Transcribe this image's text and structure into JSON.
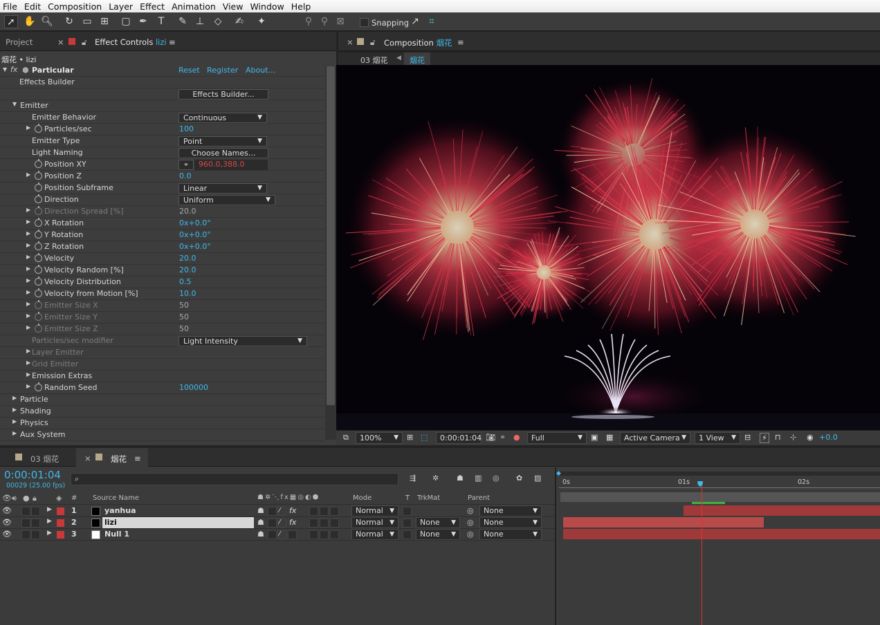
{
  "menu": [
    "File",
    "Edit",
    "Composition",
    "Layer",
    "Effect",
    "Animation",
    "View",
    "Window",
    "Help"
  ],
  "toolbar": {
    "snapping_label": "Snapping"
  },
  "left_tabs": {
    "project": "Project",
    "effect_controls_prefix": "Effect Controls",
    "effect_controls_layer": "lizi"
  },
  "breadcrumb": "烟花 • lizi",
  "effect": {
    "name": "Particular",
    "reset": "Reset",
    "register": "Register",
    "about": "About...",
    "rows": [
      {
        "label": "Effects Builder",
        "indent": 1,
        "tri": "",
        "sw": false,
        "dim": false
      },
      {
        "label": "",
        "indent": 1,
        "tri": "",
        "sw": false,
        "dim": false,
        "button": "Effects Builder..."
      },
      {
        "label": "Emitter",
        "indent": 0,
        "tri": "open",
        "sw": false,
        "dim": false
      },
      {
        "label": "Emitter Behavior",
        "indent": 2,
        "tri": "",
        "sw": false,
        "dim": false,
        "dropdown": "Continuous"
      },
      {
        "label": "Particles/sec",
        "indent": 2,
        "tri": "closed",
        "sw": true,
        "dim": false,
        "value": "100",
        "vclass": "blue"
      },
      {
        "label": "Emitter Type",
        "indent": 2,
        "tri": "",
        "sw": false,
        "dim": false,
        "dropdown": "Point"
      },
      {
        "label": "Light Naming",
        "indent": 2,
        "tri": "",
        "sw": false,
        "dim": false,
        "button": "Choose Names..."
      },
      {
        "label": "Position XY",
        "indent": 2,
        "tri": "",
        "sw": true,
        "dim": false,
        "value": "960.0,388.0",
        "vclass": "red",
        "crosshair": true
      },
      {
        "label": "Position Z",
        "indent": 2,
        "tri": "closed",
        "sw": true,
        "dim": false,
        "value": "0.0",
        "vclass": "blue"
      },
      {
        "label": "Position Subframe",
        "indent": 2,
        "tri": "",
        "sw": true,
        "dim": false,
        "dropdown": "Linear"
      },
      {
        "label": "Direction",
        "indent": 2,
        "tri": "",
        "sw": true,
        "dim": false,
        "dropdown": "Uniform",
        "ddwide": true
      },
      {
        "label": "Direction Spread [%]",
        "indent": 2,
        "tri": "closed",
        "sw": true,
        "dim": true,
        "value": "20.0",
        "vclass": "gray"
      },
      {
        "label": "X Rotation",
        "indent": 2,
        "tri": "closed",
        "sw": true,
        "dim": false,
        "value": "0x+0.0°",
        "vclass": "blue"
      },
      {
        "label": "Y Rotation",
        "indent": 2,
        "tri": "closed",
        "sw": true,
        "dim": false,
        "value": "0x+0.0°",
        "vclass": "blue"
      },
      {
        "label": "Z Rotation",
        "indent": 2,
        "tri": "closed",
        "sw": true,
        "dim": false,
        "value": "0x+0.0°",
        "vclass": "blue"
      },
      {
        "label": "Velocity",
        "indent": 2,
        "tri": "closed",
        "sw": true,
        "dim": false,
        "value": "20.0",
        "vclass": "blue"
      },
      {
        "label": "Velocity Random [%]",
        "indent": 2,
        "tri": "closed",
        "sw": true,
        "dim": false,
        "value": "20.0",
        "vclass": "blue"
      },
      {
        "label": "Velocity Distribution",
        "indent": 2,
        "tri": "closed",
        "sw": true,
        "dim": false,
        "value": "0.5",
        "vclass": "blue"
      },
      {
        "label": "Velocity from Motion [%]",
        "indent": 2,
        "tri": "closed",
        "sw": true,
        "dim": false,
        "value": "10.0",
        "vclass": "blue"
      },
      {
        "label": "Emitter Size X",
        "indent": 2,
        "tri": "closed",
        "sw": true,
        "dim": true,
        "value": "50",
        "vclass": "gray"
      },
      {
        "label": "Emitter Size Y",
        "indent": 2,
        "tri": "closed",
        "sw": true,
        "dim": true,
        "value": "50",
        "vclass": "gray"
      },
      {
        "label": "Emitter Size Z",
        "indent": 2,
        "tri": "closed",
        "sw": true,
        "dim": true,
        "value": "50",
        "vclass": "gray"
      },
      {
        "label": "Particles/sec modifier",
        "indent": 2,
        "tri": "",
        "sw": false,
        "dim": true,
        "dropdown": "Light Intensity",
        "ddlong": true
      },
      {
        "label": "Layer Emitter",
        "indent": 1,
        "tri": "closed",
        "sw": false,
        "dim": true
      },
      {
        "label": "Grid Emitter",
        "indent": 1,
        "tri": "closed",
        "sw": false,
        "dim": true
      },
      {
        "label": "Emission Extras",
        "indent": 1,
        "tri": "closed",
        "sw": false,
        "dim": false
      },
      {
        "label": "Random Seed",
        "indent": 2,
        "tri": "closed",
        "sw": true,
        "dim": false,
        "value": "100000",
        "vclass": "blue"
      },
      {
        "label": "Particle",
        "indent": 0,
        "tri": "closed",
        "sw": false,
        "dim": false
      },
      {
        "label": "Shading",
        "indent": 0,
        "tri": "closed",
        "sw": false,
        "dim": false
      },
      {
        "label": "Physics",
        "indent": 0,
        "tri": "closed",
        "sw": false,
        "dim": false
      },
      {
        "label": "Aux System",
        "indent": 0,
        "tri": "closed",
        "sw": false,
        "dim": false
      }
    ]
  },
  "comp_panel": {
    "tab_prefix": "Composition",
    "tab_comp": "烟花",
    "crumb1": "03 烟花",
    "crumb2": "烟花"
  },
  "viewer_bar": {
    "zoom": "100%",
    "time": "0:00:01:04",
    "resolution": "Full",
    "camera": "Active Camera",
    "views": "1 View",
    "exposure": "+0.0"
  },
  "timeline": {
    "tab1": "03 烟花",
    "tab2": "烟花",
    "timecode": "0:00:01:04",
    "fps": "00029 (25.00 fps)",
    "col_source": "Source Name",
    "col_mode": "Mode",
    "col_t": "T",
    "col_trkmat": "TrkMat",
    "col_parent": "Parent",
    "col_hash": "#",
    "ruler": [
      "0s",
      "01s",
      "02s"
    ],
    "layers": [
      {
        "num": "1",
        "name": "yanhua",
        "swatch": "#000000",
        "mode": "Normal",
        "trkmat": "",
        "parent": "None",
        "fx": true,
        "selected": false
      },
      {
        "num": "2",
        "name": "lizi",
        "swatch": "#000000",
        "mode": "Normal",
        "trkmat": "None",
        "parent": "None",
        "fx": true,
        "selected": true
      },
      {
        "num": "3",
        "name": "Null 1",
        "swatch": "#ffffff",
        "mode": "Normal",
        "trkmat": "None",
        "parent": "None",
        "fx": false,
        "selected": false
      }
    ]
  },
  "colors": {
    "accent": "#40b8ea",
    "label_red": "#c83a3a",
    "bar": "#a03a3a",
    "playhead": "#e03030"
  }
}
